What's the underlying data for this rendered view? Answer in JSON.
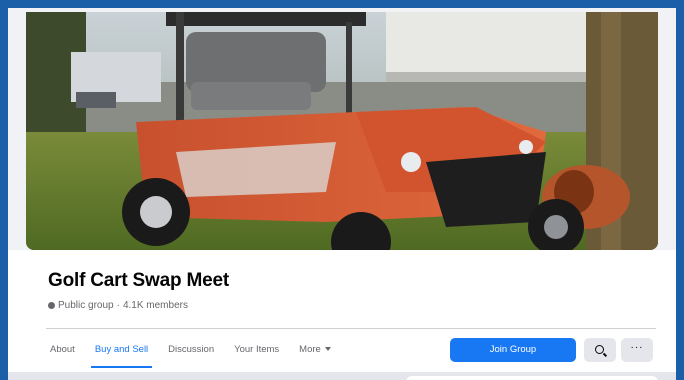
{
  "group": {
    "name": "Golf Cart Swap Meet",
    "privacy": "Public group",
    "separator": "·",
    "members": "4.1K members"
  },
  "tabs": [
    {
      "label": "About"
    },
    {
      "label": "Buy and Sell"
    },
    {
      "label": "Discussion"
    },
    {
      "label": "Your Items"
    },
    {
      "label": "More"
    }
  ],
  "actions": {
    "join_label": "Join Group",
    "search_icon": "search-icon",
    "more_icon": "ellipsis-icon",
    "more_label": "···"
  },
  "colors": {
    "accent": "#1877f2",
    "page_frame": "#1b5fa8",
    "background": "#f0f2f5"
  }
}
